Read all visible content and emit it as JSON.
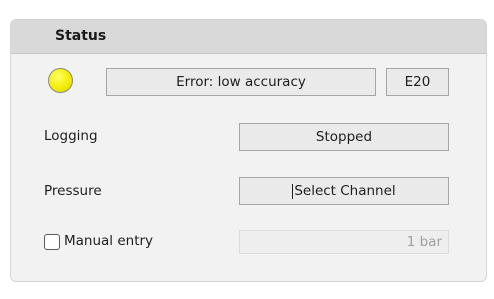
{
  "panel": {
    "title": "Status"
  },
  "status": {
    "indicator_icon": "status-led-icon",
    "indicator_color": "#f4ee00",
    "message": "Error: low accuracy",
    "code": "E20"
  },
  "logging": {
    "label": "Logging",
    "value": "Stopped"
  },
  "pressure": {
    "label": "Pressure",
    "button_label": "Select Channel"
  },
  "manual_entry": {
    "label": "Manual entry",
    "checked": false,
    "value": "1 bar"
  }
}
